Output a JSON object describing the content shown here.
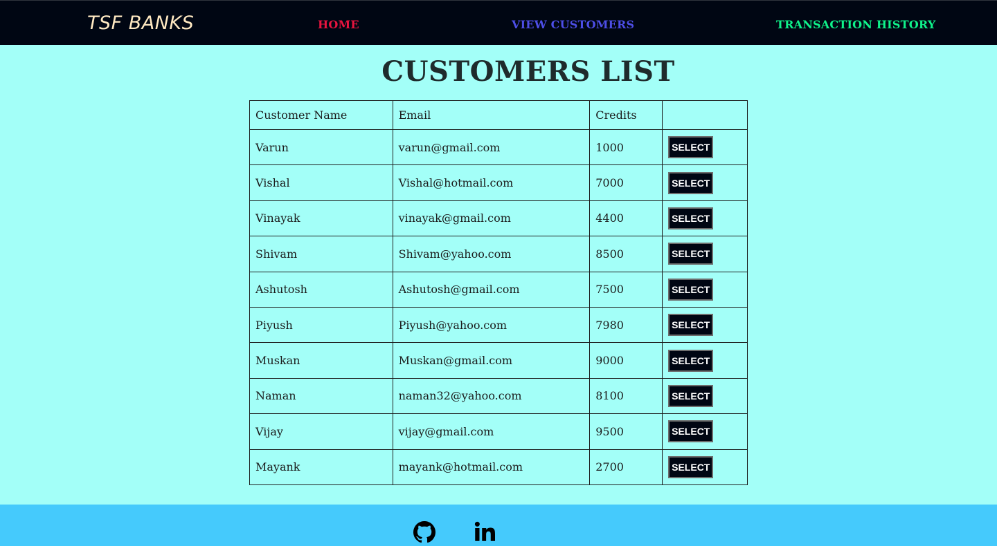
{
  "nav": {
    "brand": "TSF BANKS",
    "links": [
      {
        "label": "HOME",
        "color": "#e8143f"
      },
      {
        "label": "VIEW CUSTOMERS",
        "color": "#4d4ee6"
      },
      {
        "label": "TRANSACTION HISTORY",
        "color": "#0ff28a"
      }
    ]
  },
  "page": {
    "title": "CUSTOMERS LIST"
  },
  "table": {
    "headers": [
      "Customer Name",
      "Email",
      "Credits",
      ""
    ],
    "button_label": "SELECT",
    "rows": [
      {
        "name": "Varun",
        "email": "varun@gmail.com",
        "credits": "1000"
      },
      {
        "name": "Vishal",
        "email": "Vishal@hotmail.com",
        "credits": "7000"
      },
      {
        "name": "Vinayak",
        "email": "vinayak@gmail.com",
        "credits": "4400"
      },
      {
        "name": "Shivam",
        "email": "Shivam@yahoo.com",
        "credits": "8500"
      },
      {
        "name": "Ashutosh",
        "email": "Ashutosh@gmail.com",
        "credits": "7500"
      },
      {
        "name": "Piyush",
        "email": "Piyush@yahoo.com",
        "credits": "7980"
      },
      {
        "name": "Muskan",
        "email": "Muskan@gmail.com",
        "credits": "9000"
      },
      {
        "name": "Naman",
        "email": "naman32@yahoo.com",
        "credits": "8100"
      },
      {
        "name": "Vijay",
        "email": "vijay@gmail.com",
        "credits": "9500"
      },
      {
        "name": "Mayank",
        "email": "mayank@hotmail.com",
        "credits": "2700"
      }
    ]
  },
  "footer": {
    "icons": [
      "github-icon",
      "linkedin-icon"
    ]
  },
  "colors": {
    "page_background": "#a3fff8",
    "navbar_background": "#000613",
    "footer_background": "#45cafc",
    "brand": "#ffe9c2"
  }
}
